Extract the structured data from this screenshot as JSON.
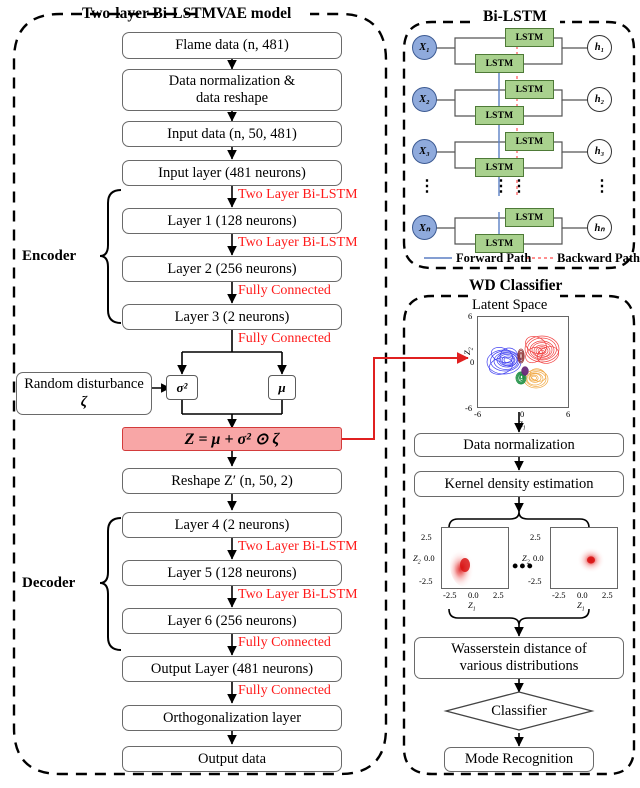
{
  "left_panel": {
    "title": "Two-layer Bi-LSTMVAE model",
    "boxes": [
      {
        "id": "flame-data",
        "text": "Flame data (n, 481)"
      },
      {
        "id": "data-norm",
        "line1": "Data  normalization &",
        "line2": "data reshape"
      },
      {
        "id": "input-data",
        "text": "Input data (n, 50, 481)"
      },
      {
        "id": "input-layer",
        "text": "Input layer (481 neurons)"
      },
      {
        "id": "layer-1",
        "text": "Layer 1 (128 neurons)"
      },
      {
        "id": "layer-2",
        "text": "Layer 2 (256 neurons)"
      },
      {
        "id": "layer-3",
        "text": "Layer 3 (2 neurons)"
      },
      {
        "id": "random-disturbance",
        "line1": "Random disturbance",
        "line2": "ζ"
      },
      {
        "id": "reshape-z",
        "text": "Reshape Z′ (n, 50, 2)"
      },
      {
        "id": "layer-4",
        "text": "Layer 4 (2 neurons)"
      },
      {
        "id": "layer-5",
        "text": "Layer 5 (128 neurons)"
      },
      {
        "id": "layer-6",
        "text": "Layer 6 (256 neurons)"
      },
      {
        "id": "output-layer",
        "text": "Output Layer (481 neurons)"
      },
      {
        "id": "orthogonalization",
        "text": "Orthogonalization layer"
      },
      {
        "id": "output-data",
        "text": "Output data"
      }
    ],
    "sigma_box": "σ²",
    "mu_box": "μ",
    "z_equation": "Z = μ + σ² ⊙ ζ",
    "red_labels": [
      "Two Layer Bi-LSTM",
      "Two Layer Bi-LSTM",
      "Fully Connected",
      "Fully Connected",
      "Two Layer Bi-LSTM",
      "Two Layer Bi-LSTM",
      "Fully Connected",
      "Fully Connected"
    ],
    "encoder_label": "Encoder",
    "decoder_label": "Decoder"
  },
  "bilstm_panel": {
    "title": "Bi-LSTM",
    "cell_label": "LSTM",
    "inputs": [
      "X₁",
      "X₂",
      "X₃",
      "Xₙ"
    ],
    "outputs": [
      "h₁",
      "h₂",
      "h₃",
      "hₙ"
    ],
    "legend": {
      "forward": "Forward Path",
      "backward": "Backward Path",
      "forward_color": "#5b7fc4",
      "backward_color": "#ff6a6a"
    },
    "ellipsis": "⋮"
  },
  "wd_panel": {
    "title": "WD Classifier",
    "latent_title": "Latent Space",
    "boxes": [
      {
        "id": "data-normalization",
        "text": "Data normalization"
      },
      {
        "id": "kde",
        "text": "Kernel density estimation"
      },
      {
        "id": "wasserstein",
        "line1": "Wasserstein distance of",
        "line2": "various distributions"
      },
      {
        "id": "mode-recognition",
        "text": "Mode Recognition"
      }
    ],
    "classifier_label": "Classifier",
    "kde_ellipsis": "•••"
  },
  "chart_data": [
    {
      "type": "scatter",
      "id": "latent-space-plot",
      "title": "Latent Space",
      "xlabel": "Z₁",
      "ylabel": "Z₂",
      "xlim": [
        -6,
        6
      ],
      "ylim": [
        -6,
        6
      ],
      "xticks": [
        -6,
        0,
        6
      ],
      "yticks": [
        -6,
        0,
        6
      ],
      "xtick_labels": [
        "-6",
        "0",
        "6"
      ],
      "ytick_labels": [
        "-6",
        "0",
        "6"
      ],
      "grid": false,
      "legend": "none",
      "clusters": [
        {
          "name": "blue",
          "color": "#2222ee",
          "cx": -2.6,
          "cy": 0.2,
          "rx": 2.3,
          "ry": 1.7
        },
        {
          "name": "red",
          "color": "#ee2222",
          "cx": 2.3,
          "cy": 1.8,
          "rx": 2.2,
          "ry": 1.8
        },
        {
          "name": "orange",
          "color": "#f0a030",
          "cx": 1.6,
          "cy": -2.1,
          "rx": 1.5,
          "ry": 1.2
        },
        {
          "name": "green",
          "color": "#118a3a",
          "cx": -0.5,
          "cy": -1.9,
          "rx": 0.55,
          "ry": 0.75
        },
        {
          "name": "purple",
          "color": "#6a2a7a",
          "cx": 0.15,
          "cy": -1.1,
          "rx": 0.38,
          "ry": 0.5
        },
        {
          "name": "darkred",
          "color": "#8a2a2a",
          "cx": -0.35,
          "cy": 0.7,
          "rx": 0.33,
          "ry": 0.95
        }
      ]
    },
    {
      "type": "heatmap",
      "id": "kde-plot-1",
      "xlabel": "Z₁",
      "ylabel": "Z₂",
      "xlim": [
        -4,
        4
      ],
      "ylim": [
        -4,
        4
      ],
      "xticks": [
        -2.5,
        0.0,
        2.5
      ],
      "yticks": [
        -2.5,
        0.0,
        2.5
      ],
      "xtick_labels": [
        "-2.5",
        "0.0",
        "2.5"
      ],
      "ytick_labels": [
        "-2.5",
        "0.0",
        "2.5"
      ],
      "peak": {
        "x": -1.3,
        "y": -0.6
      },
      "color": "#e03030"
    },
    {
      "type": "heatmap",
      "id": "kde-plot-2",
      "xlabel": "Z₁",
      "ylabel": "Z₂",
      "xlim": [
        -4,
        4
      ],
      "ylim": [
        -4,
        4
      ],
      "xticks": [
        -2.5,
        0.0,
        2.5
      ],
      "yticks": [
        -2.5,
        0.0,
        2.5
      ],
      "xtick_labels": [
        "-2.5",
        "0.0",
        "2.5"
      ],
      "ytick_labels": [
        "-2.5",
        "0.0",
        "2.5"
      ],
      "peak": {
        "x": 0.7,
        "y": -0.2
      },
      "color": "#e03030"
    }
  ]
}
